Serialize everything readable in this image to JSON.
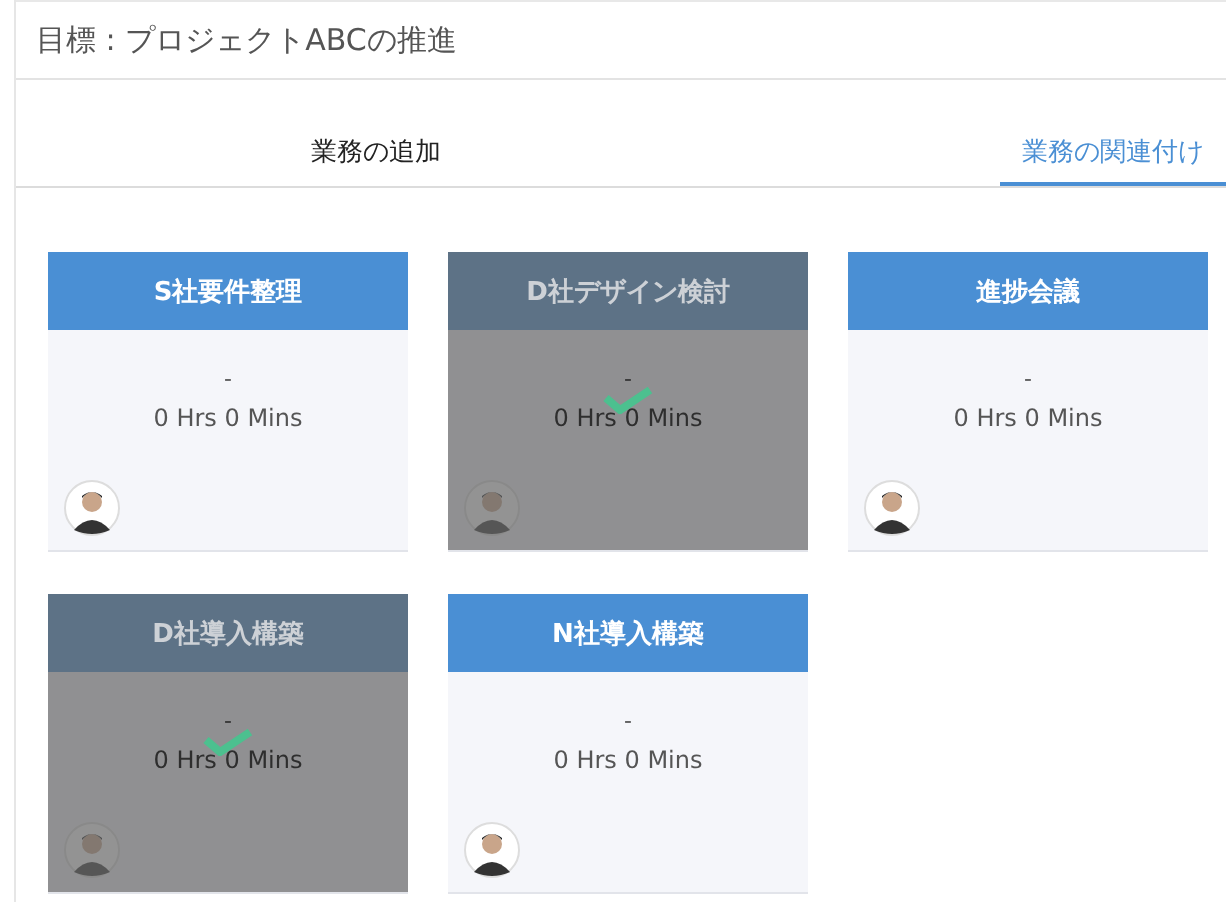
{
  "title": "目標 : プロジェクトABCの推進",
  "tabs": [
    {
      "label": "業務の追加",
      "selected": false
    },
    {
      "label": "業務の関連付け",
      "selected": true
    }
  ],
  "tasks": [
    {
      "title": "S社要件整理",
      "note": "-",
      "duration": "0 Hrs 0 Mins",
      "selected": false
    },
    {
      "title": "D社デザイン検討",
      "note": "-",
      "duration": "0 Hrs 0 Mins",
      "selected": true
    },
    {
      "title": "進捗会議",
      "note": "-",
      "duration": "0 Hrs 0 Mins",
      "selected": false
    },
    {
      "title": "D社導入構築",
      "note": "-",
      "duration": "0 Hrs 0 Mins",
      "selected": true
    },
    {
      "title": "N社導入構築",
      "note": "-",
      "duration": "0 Hrs 0 Mins",
      "selected": false
    }
  ]
}
